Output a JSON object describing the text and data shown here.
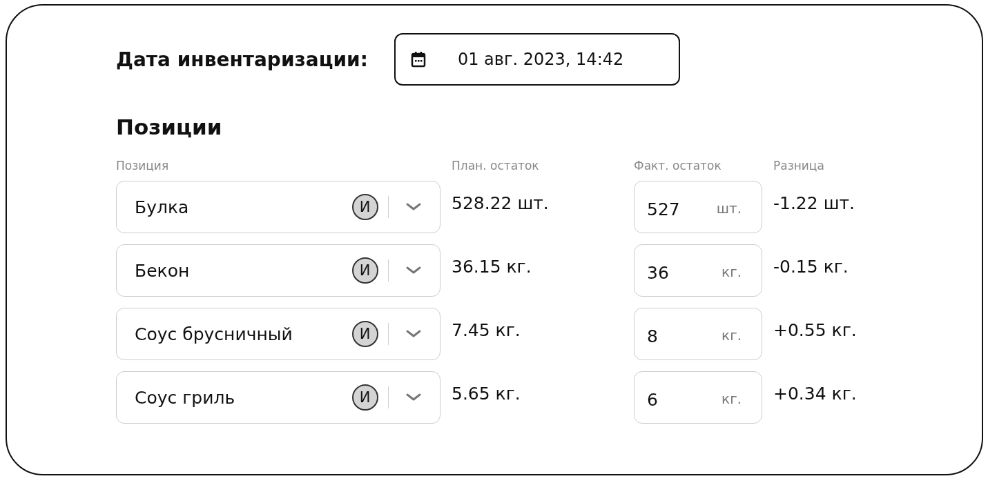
{
  "date_label": "Дата инвентаризации:",
  "date_field": {
    "value": "01 авг. 2023, 14:42"
  },
  "section_title": "Позиции",
  "columns": [
    "Позиция",
    "План. остаток",
    "Факт. остаток",
    "Разница"
  ],
  "rows": [
    {
      "item": "Булка",
      "badge": "И",
      "planned": "528.22 шт.",
      "actual": "527",
      "unit": "шт.",
      "difference": "-1.22 шт."
    },
    {
      "item": "Бекон",
      "badge": "И",
      "planned": "36.15 кг.",
      "actual": "36",
      "unit": "кг.",
      "difference": "-0.15 кг."
    },
    {
      "item": "Соус брусничный",
      "badge": "И",
      "planned": "7.45 кг.",
      "actual": "8",
      "unit": "кг.",
      "difference": "+0.55 кг."
    },
    {
      "item": "Соус гриль",
      "badge": "И",
      "planned": "5.65 кг.",
      "actual": "6",
      "unit": "кг.",
      "difference": "+0.34 кг."
    }
  ]
}
